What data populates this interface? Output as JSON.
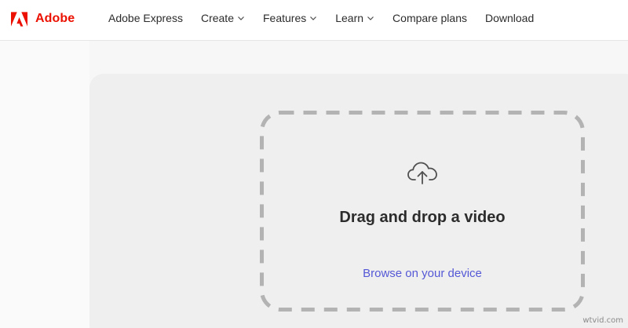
{
  "header": {
    "brand_name": "Adobe",
    "brand_color": "#eb1000",
    "nav": [
      {
        "label": "Adobe Express",
        "has_dropdown": false
      },
      {
        "label": "Create",
        "has_dropdown": true
      },
      {
        "label": "Features",
        "has_dropdown": true
      },
      {
        "label": "Learn",
        "has_dropdown": true
      },
      {
        "label": "Compare plans",
        "has_dropdown": false
      },
      {
        "label": "Download",
        "has_dropdown": false
      }
    ]
  },
  "upload": {
    "icon": "cloud-upload-icon",
    "title": "Drag and drop a video",
    "browse_label": "Browse on your device",
    "link_color": "#5558d6"
  },
  "watermark": "wtvid.com"
}
